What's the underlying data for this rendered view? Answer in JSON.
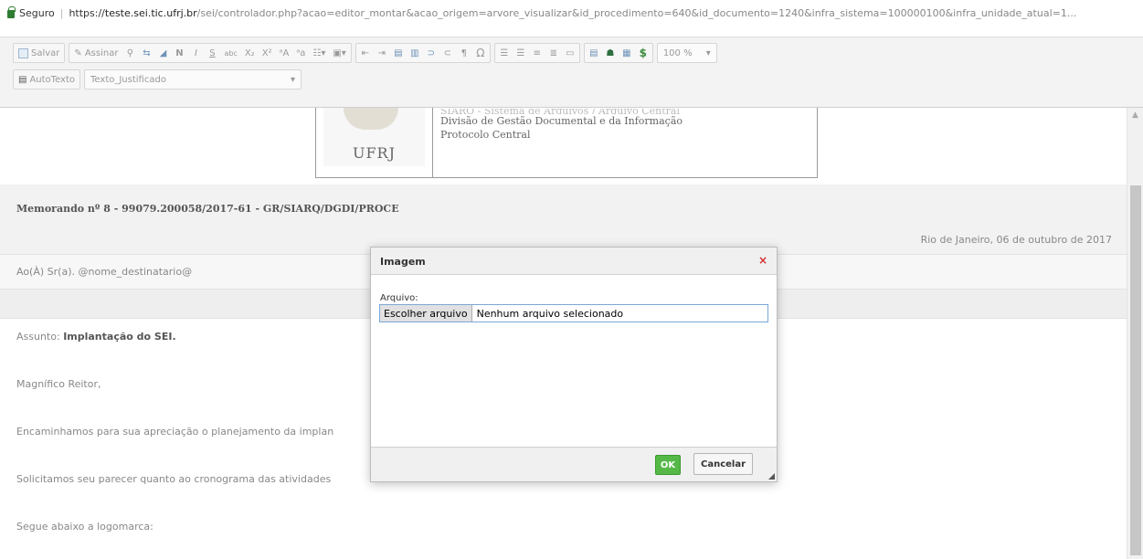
{
  "address_bar": {
    "secure_label": "Seguro",
    "url_prefix": "https://",
    "url_host": "teste.sei.tic.ufrj.br",
    "url_rest": "/sei/controlador.php?acao=editor_montar&acao_origem=arvore_visualizar&id_procedimento=640&id_documento=1240&infra_sistema=100000100&infra_unidade_atual=1..."
  },
  "toolbar": {
    "save_label": "Salvar",
    "sign_label": "Assinar",
    "bold_glyph": "N",
    "italic_glyph": "I",
    "underline_glyph": "S",
    "strike_glyph": "abc",
    "sub_glyph": "X₂",
    "sup_glyph": "X²",
    "omega_glyph": "Ω",
    "pilcrow_glyph": "¶",
    "dollar_glyph": "$",
    "zoom_value": "100 %",
    "autotext_label": "AutoTexto",
    "style_value": "Texto_Justificado"
  },
  "document": {
    "header_line1": "SIARQ - Sistema de Arquivos / Arquivo Central",
    "header_line2": "Divisão de Gestão Documental e da Informação",
    "header_line3": "Protocolo Central",
    "logo_text": "UFRJ",
    "memo_title": "Memorando nº 8 - 99079.200058/2017-61 - GR/SIARQ/DGDI/PROCE",
    "date": "Rio de Janeiro, 06 de outubro de 2017",
    "recipient": "Ao(À) Sr(a). @nome_destinatario@",
    "subject_label": "Assunto: ",
    "subject_value": "Implantação do SEI.",
    "salutation": "Magnífico Reitor,",
    "paragraph1": "Encaminhamos para sua apreciação o planejamento da implan",
    "paragraph2": "Solicitamos seu parecer quanto ao cronograma das atividades",
    "paragraph3": "Segue abaixo a logomarca:"
  },
  "dialog": {
    "title": "Imagem",
    "close_glyph": "×",
    "file_label": "Arquivo:",
    "choose_button": "Escolher arquivo",
    "no_file_text": "Nenhum arquivo selecionado",
    "ok_label": "OK",
    "cancel_label": "Cancelar"
  },
  "colors": {
    "ok_green": "#55b847",
    "close_red": "#d32f2f",
    "secure_green": "#2e7d32"
  }
}
